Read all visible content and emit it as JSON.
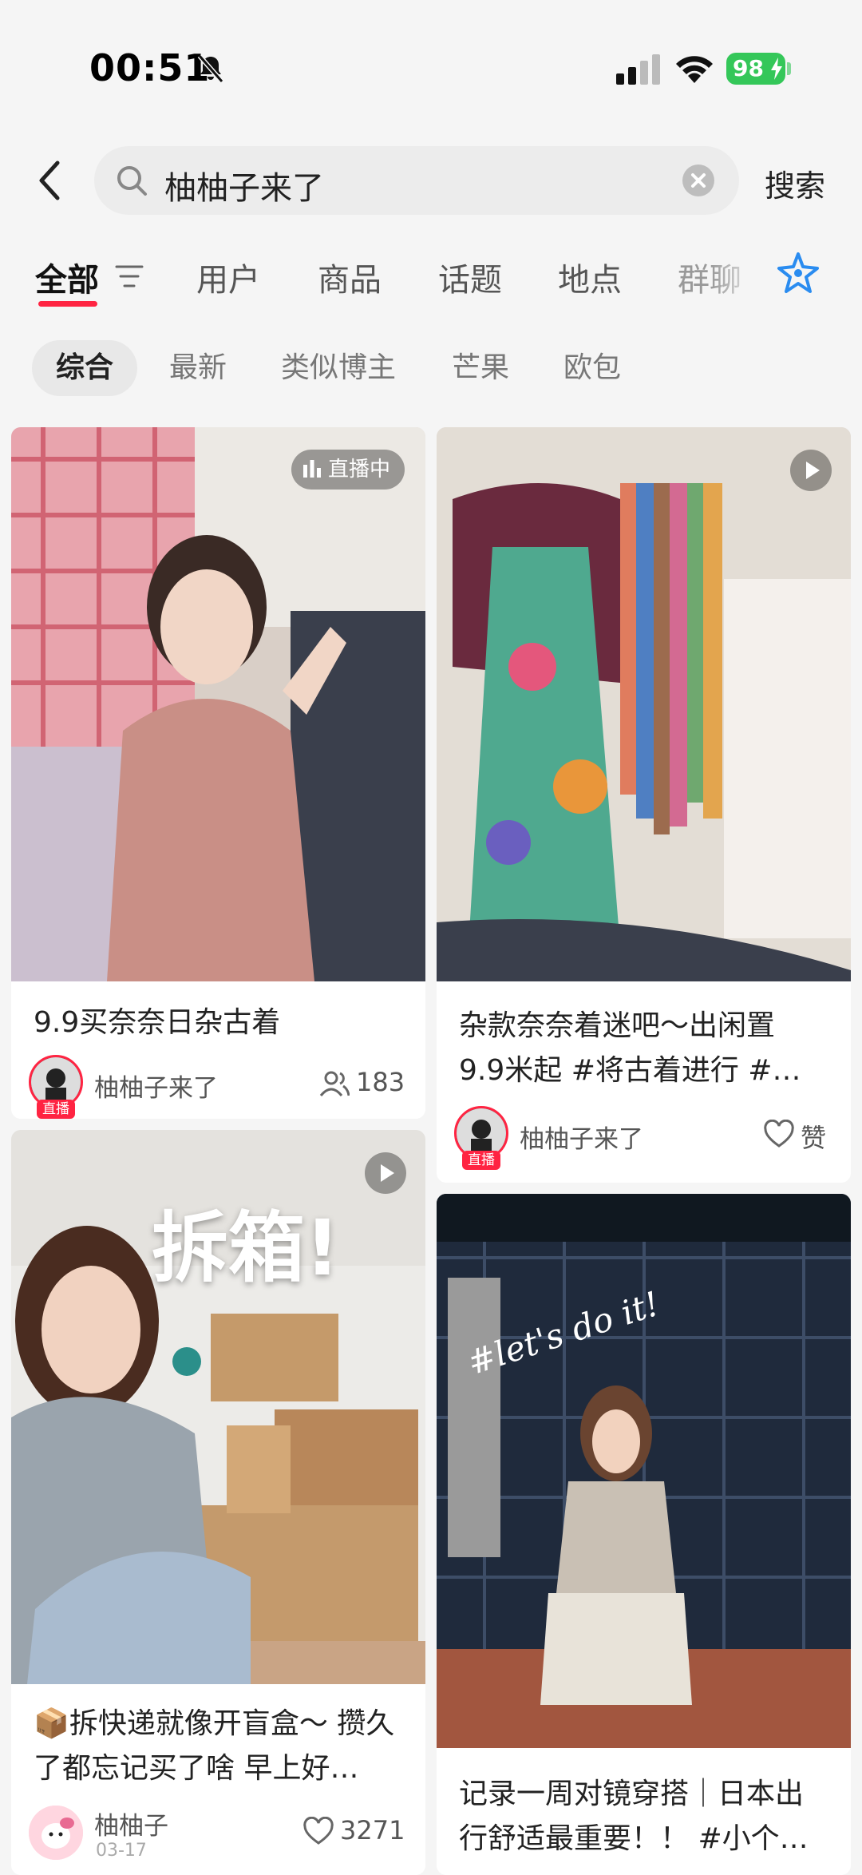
{
  "status_bar": {
    "time": "00:51",
    "battery": "98"
  },
  "search": {
    "query": "柚柚子来了",
    "button_label": "搜索"
  },
  "tabs": [
    {
      "label": "全部"
    },
    {
      "label": "用户"
    },
    {
      "label": "商品"
    },
    {
      "label": "话题"
    },
    {
      "label": "地点"
    },
    {
      "label": "群聊"
    }
  ],
  "chips": [
    {
      "label": "综合"
    },
    {
      "label": "最新"
    },
    {
      "label": "类似博主"
    },
    {
      "label": "芒果"
    },
    {
      "label": "欧包"
    }
  ],
  "feed": {
    "cards": [
      {
        "title": "9.9买奈奈日杂古着",
        "author": "柚柚子来了",
        "stat": "183",
        "badge": "直播中",
        "avatar_tag": "直播"
      },
      {
        "title": "杂款奈奈着迷吧～出闲置 9.9米起 #将古着进行 #…",
        "author": "柚柚子来了",
        "stat": "赞",
        "avatar_tag": "直播"
      },
      {
        "title": "📦拆快递就像开盲盒～ 攒久了都忘记买了啥 早上好…",
        "author": "柚柚子",
        "date": "03-17",
        "stat": "3271",
        "overlay_text": "拆箱!"
      },
      {
        "title": "记录一周对镜穿搭｜日本出行舒适最重要！！ #小个…",
        "overlay_text": "#let's do it!"
      }
    ]
  }
}
